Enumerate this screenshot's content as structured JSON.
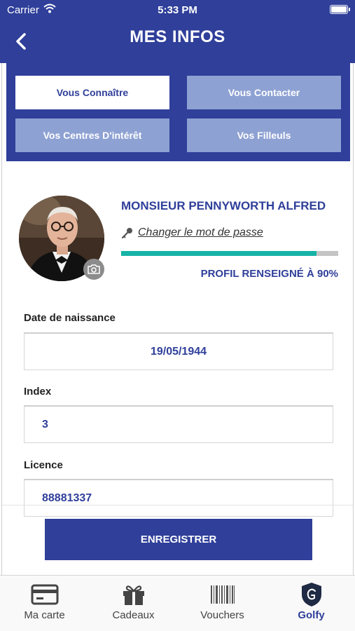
{
  "status_bar": {
    "carrier": "Carrier",
    "time": "5:33 PM"
  },
  "nav": {
    "title": "MES INFOS",
    "back_icon": "chevron-left-icon"
  },
  "tabs": [
    {
      "label": "Vous Connaître",
      "active": true
    },
    {
      "label": "Vous Contacter",
      "active": false
    },
    {
      "label": "Vos Centres D'intérêt",
      "active": false
    },
    {
      "label": "Vos Filleuls",
      "active": false
    }
  ],
  "profile": {
    "name": "MONSIEUR PENNYWORTH ALFRED",
    "change_password": "Changer le mot de passe",
    "progress_label": "PROFIL RENSEIGNÉ À 90%",
    "progress_value": 0.9
  },
  "form": {
    "birthdate": {
      "label": "Date de naissance",
      "value": "19/05/1944"
    },
    "index": {
      "label": "Index",
      "value": "3"
    },
    "licence": {
      "label": "Licence",
      "value": "88881337"
    }
  },
  "save_button": "ENREGISTRER",
  "tab_bar": [
    {
      "label": "Ma carte",
      "icon": "card-icon",
      "active": false
    },
    {
      "label": "Cadeaux",
      "icon": "gift-icon",
      "active": false
    },
    {
      "label": "Vouchers",
      "icon": "barcode-icon",
      "active": false
    },
    {
      "label": "Golfy",
      "icon": "golfy-logo-icon",
      "active": true
    }
  ],
  "colors": {
    "primary": "#2f3f9a",
    "tab_inactive": "#8ea1d3",
    "progress": "#16b3a6",
    "progress_track": "#c4c4c4"
  }
}
